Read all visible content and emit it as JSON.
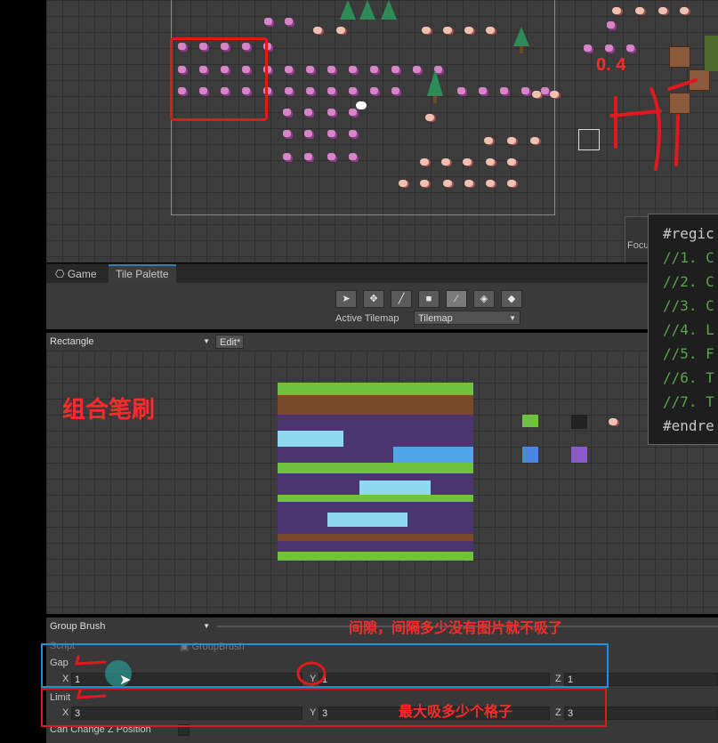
{
  "scene": {
    "focus_label": "Focu"
  },
  "tabs": [
    {
      "icon": "gamepad-icon",
      "label": "Game"
    },
    {
      "label": "Tile Palette"
    }
  ],
  "toolbar": {
    "tools": [
      "select-tool",
      "move-tool",
      "paint-tool",
      "box-fill-tool",
      "picker-tool",
      "erase-tool",
      "fill-tool"
    ],
    "active_tilemap_label": "Active Tilemap",
    "active_tilemap_value": "Tilemap"
  },
  "palette_row": {
    "palette_value": "Rectangle",
    "edit_label": "Edit*"
  },
  "brush": {
    "value": "Group Brush"
  },
  "inspector": {
    "script_label": "Script",
    "script_value": "GroupBrush",
    "gap_label": "Gap",
    "gap": {
      "x": "1",
      "y": "1",
      "z": "1"
    },
    "limit_label": "Limit",
    "limit": {
      "x": "3",
      "y": "3",
      "z": "3"
    },
    "can_change_z_label": "Can Change Z Position",
    "axis_x": "X",
    "axis_y": "Y",
    "axis_z": "Z"
  },
  "code": {
    "lines": [
      "#regic",
      "//1. C",
      "//2. C",
      "//3. C",
      "//4. L",
      "//5. F",
      "//6. T",
      "//7. T",
      "#endre"
    ],
    "colors": {
      "directive": "#c8c8c8",
      "comment": "#57a64a"
    }
  },
  "annotations": {
    "title": "组合笔刷",
    "gap_note": "间隙，间隔多少没有图片就不吸了",
    "limit_note": "最大吸多少个格子",
    "scribble": "0. 4",
    "color": "#e0191e"
  }
}
